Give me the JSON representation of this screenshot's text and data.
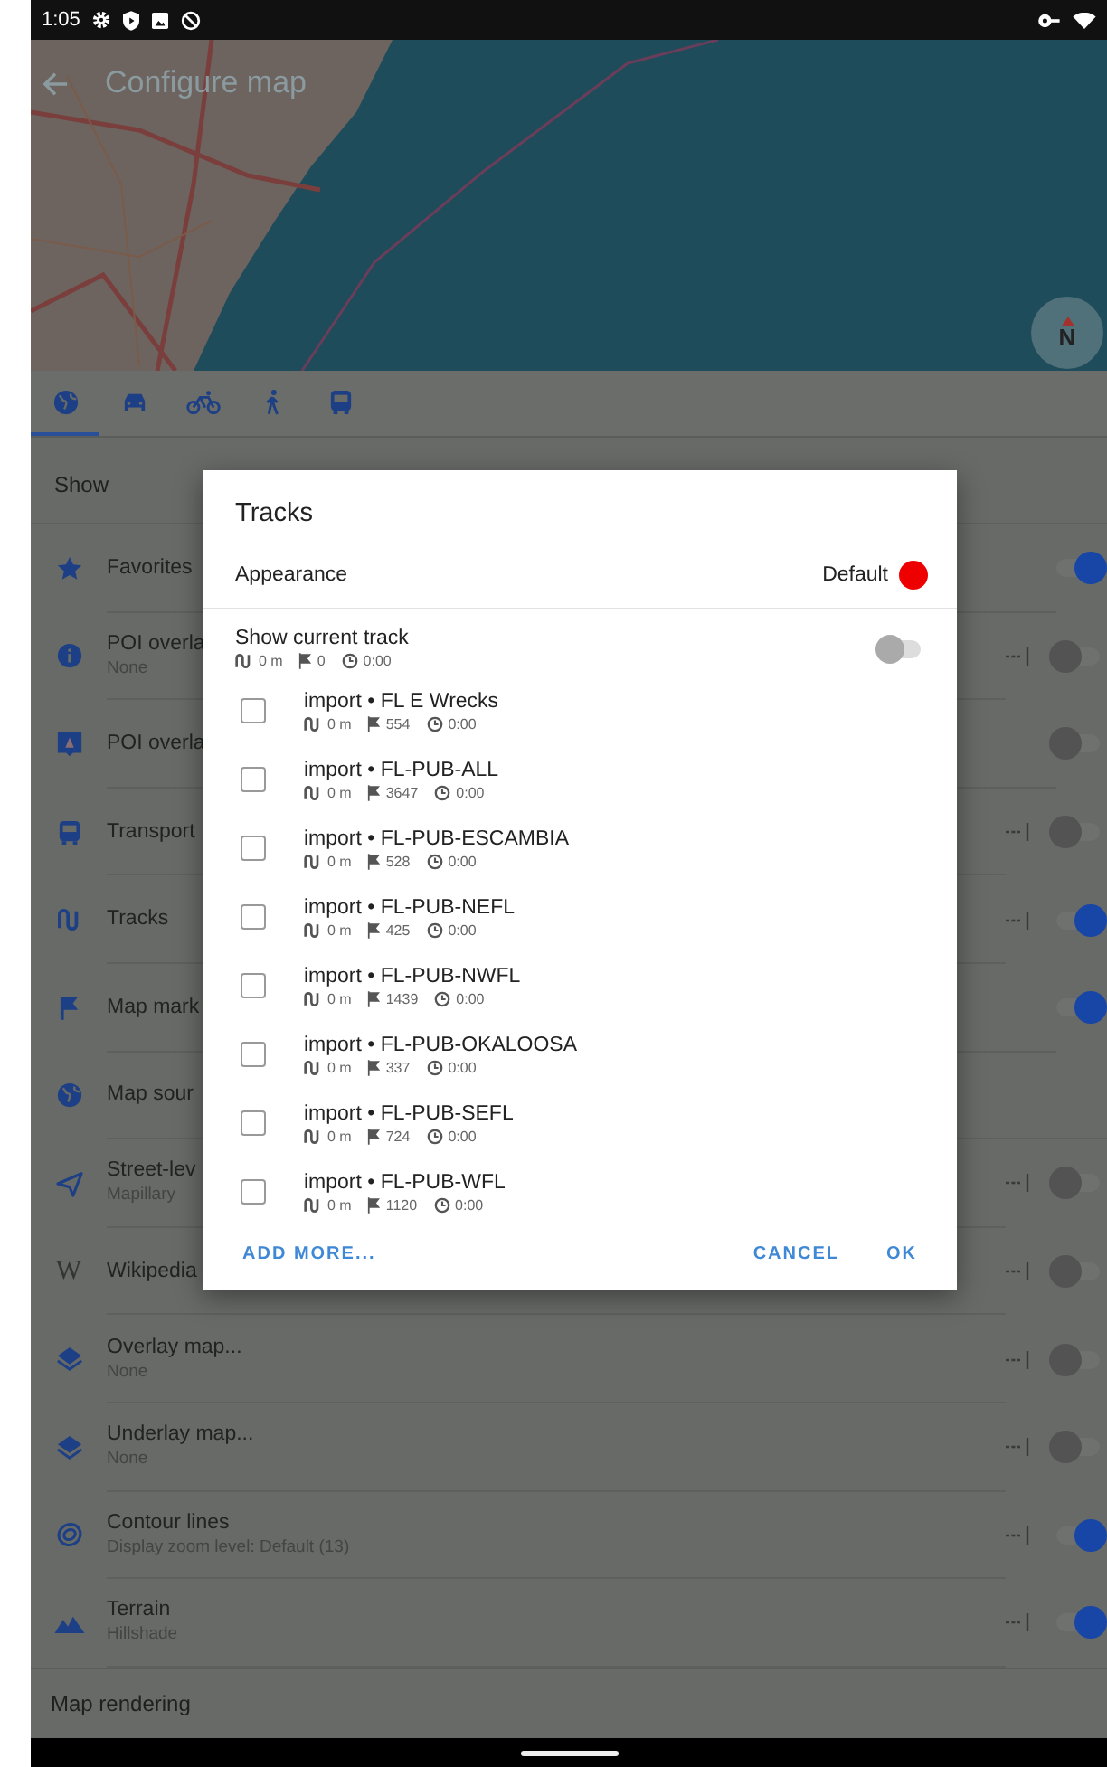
{
  "status_bar": {
    "time": "1:05"
  },
  "toolbar": {
    "title": "Configure map"
  },
  "compass": {
    "label": "N"
  },
  "tabs": [
    {
      "kind": "globe",
      "selected": true
    },
    {
      "kind": "car",
      "selected": false
    },
    {
      "kind": "bicycle",
      "selected": false
    },
    {
      "kind": "walker",
      "selected": false
    },
    {
      "kind": "bus",
      "selected": false
    }
  ],
  "section_title": "Show",
  "layers": [
    {
      "kind": "star",
      "title": "Favorites",
      "on": true,
      "has_options": false
    },
    {
      "kind": "info",
      "title": "POI overla",
      "subtitle": "None",
      "on": false,
      "has_options": true
    },
    {
      "kind": "poi",
      "title": "POI overla",
      "on": false,
      "has_options": false
    },
    {
      "kind": "bus",
      "title": "Transport",
      "on": false,
      "has_options": true
    },
    {
      "kind": "track",
      "title": "Tracks",
      "on": true,
      "has_options": true
    },
    {
      "kind": "flag",
      "title": "Map mark",
      "on": true,
      "has_options": false
    },
    {
      "kind": "globe",
      "title": "Map sour"
    },
    {
      "kind": "street",
      "title": "Street-lev",
      "subtitle": "Mapillary",
      "on": false,
      "has_options": true
    },
    {
      "kind": "glyph",
      "glyph": "W",
      "title": "Wikipedia",
      "on": false,
      "has_options": true
    },
    {
      "kind": "layers",
      "title": "Overlay map...",
      "subtitle": "None",
      "on": false,
      "has_options": true
    },
    {
      "kind": "layers",
      "title": "Underlay map...",
      "subtitle": "None",
      "on": false,
      "has_options": true
    },
    {
      "kind": "contour",
      "title": "Contour lines",
      "subtitle": "Display zoom level: Default (13)",
      "on": true,
      "has_options": true
    },
    {
      "kind": "terrain",
      "title": "Terrain",
      "subtitle": "Hillshade",
      "on": true,
      "has_options": true
    }
  ],
  "footer_section": "Map rendering",
  "dialog": {
    "title": "Tracks",
    "appearance": {
      "label": "Appearance",
      "value": "Default",
      "color": "#ee0000"
    },
    "current_track": {
      "label": "Show current track",
      "distance": "0 m",
      "points": "0",
      "time": "0:00",
      "on": false
    },
    "tracks": [
      {
        "name": "import • FL E Wrecks",
        "distance": "0 m",
        "points": "554",
        "time": "0:00",
        "checked": false
      },
      {
        "name": "import • FL-PUB-ALL",
        "distance": "0 m",
        "points": "3647",
        "time": "0:00",
        "checked": false
      },
      {
        "name": "import • FL-PUB-ESCAMBIA",
        "distance": "0 m",
        "points": "528",
        "time": "0:00",
        "checked": false
      },
      {
        "name": "import • FL-PUB-NEFL",
        "distance": "0 m",
        "points": "425",
        "time": "0:00",
        "checked": false
      },
      {
        "name": "import • FL-PUB-NWFL",
        "distance": "0 m",
        "points": "1439",
        "time": "0:00",
        "checked": false
      },
      {
        "name": "import • FL-PUB-OKALOOSA",
        "distance": "0 m",
        "points": "337",
        "time": "0:00",
        "checked": false
      },
      {
        "name": "import • FL-PUB-SEFL",
        "distance": "0 m",
        "points": "724",
        "time": "0:00",
        "checked": false
      },
      {
        "name": "import • FL-PUB-WFL",
        "distance": "0 m",
        "points": "1120",
        "time": "0:00",
        "checked": false
      }
    ],
    "buttons": {
      "add_more": "ADD MORE...",
      "cancel": "CANCEL",
      "ok": "OK"
    }
  }
}
